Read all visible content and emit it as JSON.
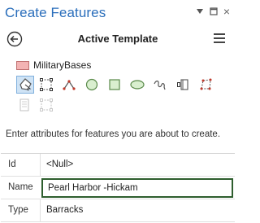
{
  "pane": {
    "title": "Create Features",
    "controls": [
      "pin-icon",
      "maximize-icon",
      "close-icon"
    ],
    "close_glyph": "×"
  },
  "template": {
    "title": "Active Template",
    "back_icon": "back-arrow-icon",
    "menu_icon": "hamburger-menu-icon"
  },
  "layer": {
    "name": "MilitaryBases",
    "swatch_color": "#f3b3b3"
  },
  "tools": [
    {
      "name": "polygon-tool-icon",
      "selected": true
    },
    {
      "name": "rectangle-tool-icon"
    },
    {
      "name": "triangle-tool-icon"
    },
    {
      "name": "circle-tool-icon"
    },
    {
      "name": "square-tool-icon"
    },
    {
      "name": "ellipse-tool-icon"
    },
    {
      "name": "freehand-tool-icon"
    },
    {
      "name": "trace-tool-icon"
    },
    {
      "name": "right-angle-tool-icon"
    },
    {
      "name": "autocomplete-polygon-tool-icon",
      "disabled": true
    },
    {
      "name": "autocomplete-freehand-tool-icon",
      "disabled": true
    }
  ],
  "prompt": "Enter attributes for features you are about to create.",
  "attributes": {
    "id": {
      "label": "Id",
      "value": "<Null>"
    },
    "name": {
      "label": "Name",
      "value": "Pearl Harbor -Hickam"
    },
    "type": {
      "label": "Type",
      "value": "Barracks"
    }
  },
  "colors": {
    "title_blue": "#2a6ebb",
    "selected_bg": "#cfe3f5",
    "input_border": "#2e5e2e"
  }
}
